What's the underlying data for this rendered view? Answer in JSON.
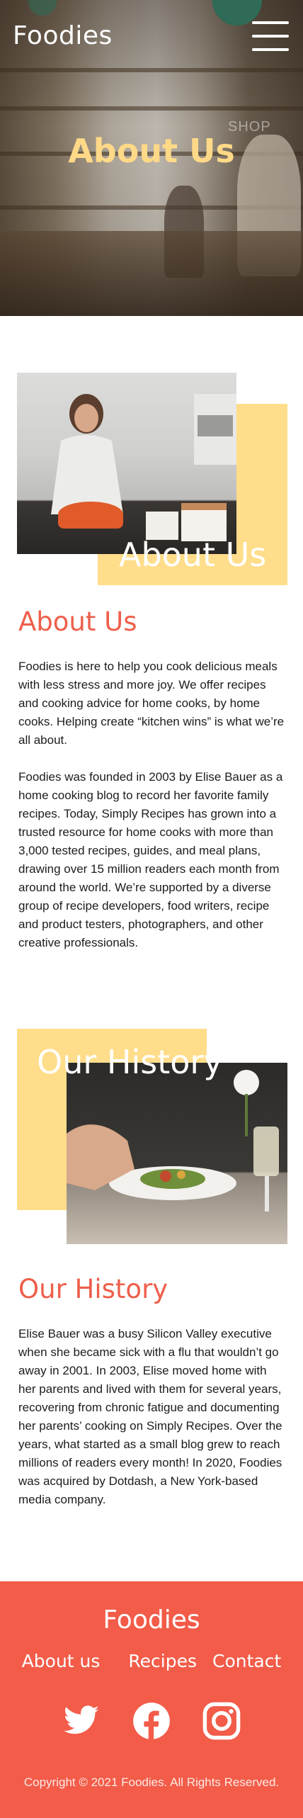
{
  "header": {
    "logo": "Foodies",
    "menu_icon": "hamburger-menu-icon",
    "hero_title": "About Us",
    "background_sign": "SHOP"
  },
  "about": {
    "image_overlay_title": "About Us",
    "heading": "About Us",
    "paragraph_1": "Foodies is here to help you cook delicious meals with less stress and more joy. We offer recipes and cooking advice for home cooks, by home cooks. Helping create “kitchen wins” is what we’re all about.",
    "paragraph_2": "Foodies was founded in 2003 by Elise Bauer as a home cooking blog to record her favorite family recipes. Today, Simply Recipes has grown into a trusted resource for home cooks with more than 3,000 tested recipes, guides, and meal plans, drawing over 15 million readers each month from around the world. We’re supported by a diverse group of recipe developers, food writers, recipe and product testers, photographers, and other creative professionals."
  },
  "history": {
    "image_overlay_title": "Our History",
    "heading": "Our History",
    "paragraph": "Elise Bauer was a busy Silicon Valley executive when she became sick with a flu that wouldn’t go away in 2001. In 2003, Elise moved home with her parents and lived with them for several years, recovering from chronic fatigue and documenting her parents’ cooking on Simply Recipes. Over the years, what started as a small blog grew to reach millions of readers every month! In 2020, Foodies was acquired by Dotdash, a New York-based media company."
  },
  "footer": {
    "logo": "Foodies",
    "nav": [
      "About us",
      "Recipes",
      "Contact"
    ],
    "social_icons": [
      "twitter-icon",
      "facebook-icon",
      "instagram-icon"
    ],
    "copyright": "Copyright © 2021 Foodies. All Rights Reserved."
  },
  "colors": {
    "accent": "#f25c49",
    "heading": "#ee5f4b",
    "yellow_block": "#ffdd8a",
    "hero_title": "#ffd987"
  }
}
